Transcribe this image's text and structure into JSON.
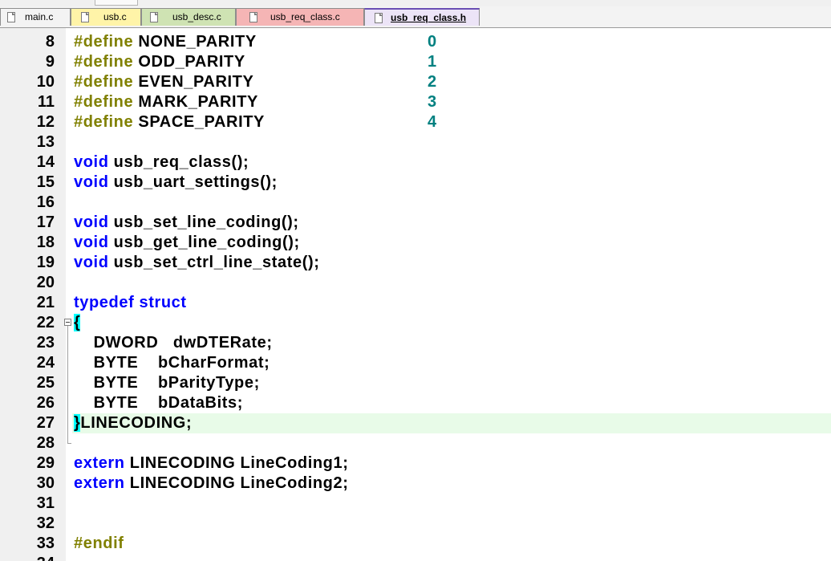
{
  "tabs": [
    {
      "label": "main.c",
      "color": "#f3f3f3",
      "active": false
    },
    {
      "label": "usb.c",
      "color": "#fff4a8",
      "active": false
    },
    {
      "label": "usb_desc.c",
      "color": "#cfe3b3",
      "active": false
    },
    {
      "label": "usb_req_class.c",
      "color": "#f5b5b5",
      "active": false
    },
    {
      "label": "usb_req_class.h",
      "color": "#ece4f7",
      "active": true
    }
  ],
  "colors": {
    "preprocessor": "#808000",
    "keyword": "#0000ff",
    "number": "#008080",
    "brace_match": "#00ffff",
    "current_line": "#e8fbe8",
    "gutter": "#f0f0f0"
  },
  "code_lines": [
    {
      "num": "8",
      "kind": "define",
      "pp": "#define",
      "name": " NONE_PARITY",
      "value": "0"
    },
    {
      "num": "9",
      "kind": "define",
      "pp": "#define",
      "name": " ODD_PARITY",
      "value": "1"
    },
    {
      "num": "10",
      "kind": "define",
      "pp": "#define",
      "name": " EVEN_PARITY",
      "value": "2"
    },
    {
      "num": "11",
      "kind": "define",
      "pp": "#define",
      "name": " MARK_PARITY",
      "value": "3"
    },
    {
      "num": "12",
      "kind": "define",
      "pp": "#define",
      "name": " SPACE_PARITY",
      "value": "4"
    },
    {
      "num": "13",
      "kind": "blank"
    },
    {
      "num": "14",
      "kind": "decl",
      "kw": "void",
      "rest": " usb_req_class();"
    },
    {
      "num": "15",
      "kind": "decl",
      "kw": "void",
      "rest": " usb_uart_settings();"
    },
    {
      "num": "16",
      "kind": "blank"
    },
    {
      "num": "17",
      "kind": "decl",
      "kw": "void",
      "rest": " usb_set_line_coding();"
    },
    {
      "num": "18",
      "kind": "decl",
      "kw": "void",
      "rest": " usb_get_line_coding();"
    },
    {
      "num": "19",
      "kind": "decl",
      "kw": "void",
      "rest": " usb_set_ctrl_line_state();"
    },
    {
      "num": "20",
      "kind": "blank"
    },
    {
      "num": "21",
      "kind": "typedef",
      "kw": "typedef struct"
    },
    {
      "num": "22",
      "kind": "open",
      "brace": "{"
    },
    {
      "num": "23",
      "kind": "field",
      "text": "    DWORD   dwDTERate;"
    },
    {
      "num": "24",
      "kind": "field",
      "text": "    BYTE    bCharFormat;"
    },
    {
      "num": "25",
      "kind": "field",
      "text": "    BYTE    bParityType;"
    },
    {
      "num": "26",
      "kind": "field",
      "text": "    BYTE    bDataBits;"
    },
    {
      "num": "27",
      "kind": "close",
      "brace": "}",
      "rest": "LINECODING;"
    },
    {
      "num": "28",
      "kind": "blank"
    },
    {
      "num": "29",
      "kind": "decl",
      "kw": "extern",
      "rest": " LINECODING LineCoding1;"
    },
    {
      "num": "30",
      "kind": "decl",
      "kw": "extern",
      "rest": " LINECODING LineCoding2;"
    },
    {
      "num": "31",
      "kind": "blank"
    },
    {
      "num": "32",
      "kind": "blank"
    },
    {
      "num": "33",
      "kind": "endif",
      "pp": "#endif"
    }
  ],
  "partial_next_line": "34"
}
